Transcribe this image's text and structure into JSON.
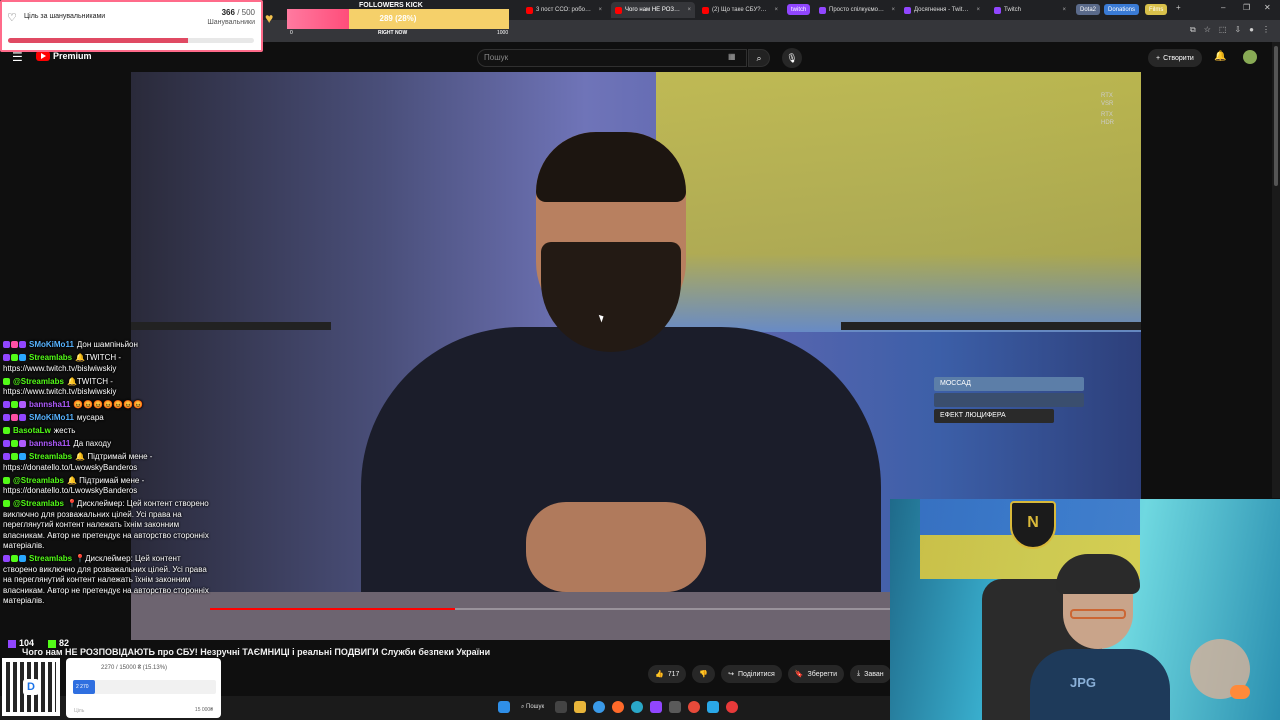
{
  "browser": {
    "tabs": [
      {
        "label": "3 пост ССО: робо…",
        "color": "#ff0000"
      },
      {
        "label": "Чого нам НЕ РОЗ…",
        "color": "#ff0000",
        "active": true
      },
      {
        "label": "(2) Що таке СБУ?…",
        "color": "#ff0000"
      },
      {
        "label": "Просто спілкуємо…",
        "color": "#9146ff"
      },
      {
        "label": "Досягнення - Twit…",
        "color": "#9146ff"
      },
      {
        "label": "Twitch",
        "color": "#9146ff"
      }
    ],
    "pills": [
      {
        "label": "twitch",
        "color": "#9146ff"
      },
      {
        "label": "Dota2",
        "color": "#5a6a8a"
      },
      {
        "label": "Donations",
        "color": "#3a7bd5"
      },
      {
        "label": "Films",
        "color": "#d8c04a"
      }
    ],
    "window_controls": [
      "–",
      "❐",
      "✕"
    ]
  },
  "youtube": {
    "logo_text": "Premium",
    "search_placeholder": "Пошук",
    "create_label": "Створити",
    "video_title": "Чого нам НЕ РОЗПОВІДАЮТЬ про СБУ! Незручні ТАЄМНИЦІ і реальні ПОДВИГИ Служби безпеки України",
    "likes": "717",
    "share_label": "Поділитися",
    "save_label": "Зберегти",
    "download_label": "Заван",
    "progress_fraction": 0.36,
    "overlay_text": [
      "RTX",
      "VSR",
      "RTX",
      "HDR"
    ],
    "books": [
      {
        "label": "МОССАД",
        "color": "#5c7ea8"
      },
      {
        "label": "",
        "color": "#3a4e6e"
      },
      {
        "label": "ЕФЕКТ ЛЮЦИФЕРА",
        "color": "#2a2a2a"
      }
    ]
  },
  "goal_widget": {
    "label": "Ціль за шанувальниками",
    "current": "366",
    "separator": " / ",
    "target": "500",
    "sub": "Шанувальники",
    "fraction": 0.732
  },
  "kick_widget": {
    "title": "FOLLOWERS KICK",
    "value": "289 (28%)",
    "fraction": 0.28,
    "min": "0",
    "mid": "RIGHT NOW",
    "max": "1000"
  },
  "chat": [
    {
      "user": "SMoKiMo11",
      "color": "#57b3ff",
      "badges": [
        "#9146ff",
        "#ff4fa3",
        "#9146ff"
      ],
      "text": "Дон шампіньйон"
    },
    {
      "user": "Streamlabs",
      "color": "#53fc18",
      "badges": [
        "#9146ff",
        "#53fc18",
        "#2aa8ff"
      ],
      "text": "🔔TWITCH - https://www.twitch.tv/bislwiwskiy"
    },
    {
      "user": "@Streamlabs",
      "color": "#53fc18",
      "badges": [
        "#53fc18"
      ],
      "text": "🔔TWITCH - https://www.twitch.tv/bislwiwskiy"
    },
    {
      "user": "bannsha11",
      "color": "#b05cff",
      "badges": [
        "#9146ff",
        "#53fc18",
        "#b05cff"
      ],
      "text": "😡😡😡😡😡😡😡"
    },
    {
      "user": "SMoKiMo11",
      "color": "#57b3ff",
      "badges": [
        "#9146ff",
        "#ff4fa3",
        "#9146ff"
      ],
      "text": "мусара"
    },
    {
      "user": "BasotaLw",
      "color": "#53fc18",
      "badges": [
        "#53fc18"
      ],
      "text": "жесть"
    },
    {
      "user": "bannsha11",
      "color": "#b05cff",
      "badges": [
        "#9146ff",
        "#53fc18",
        "#b05cff"
      ],
      "text": "Да паходу"
    },
    {
      "user": "Streamlabs",
      "color": "#53fc18",
      "badges": [
        "#9146ff",
        "#53fc18",
        "#2aa8ff"
      ],
      "text": "🔔 Підтримай мене - https://donatello.to/LwowskyBanderos"
    },
    {
      "user": "@Streamlabs",
      "color": "#53fc18",
      "badges": [
        "#53fc18"
      ],
      "text": "🔔 Підтримай мене - https://donatello.to/LwowskyBanderos"
    },
    {
      "user": "@Streamlabs",
      "color": "#53fc18",
      "badges": [
        "#53fc18"
      ],
      "text": "📍Дисклеймер: Цей контент створено виключно для розважальних цілей. Усі права на переглянутий контент належать їхнім законним власникам. Автор не претендує на авторство сторонніх матеріалів."
    },
    {
      "user": "Streamlabs",
      "color": "#53fc18",
      "badges": [
        "#9146ff",
        "#53fc18",
        "#2aa8ff"
      ],
      "text": "📍Дисклеймер: Цей контент створено виключно для розважальних цілей. Усі права на переглянутий контент належать їхнім законним власникам. Автор не претендує на авторство сторонніх матеріалів."
    }
  ],
  "counters": {
    "twitch_viewers": "104",
    "kick_viewers": "82",
    "twitch_color": "#9146ff",
    "kick_color": "#53fc18"
  },
  "donation": {
    "progress_text": "2270 / 15000 ₴ (15.13%)",
    "bar_text": "2 270",
    "goal_label": "Ціль",
    "goal_amount": "15 000₴",
    "fraction": 0.1513
  },
  "taskbar": {
    "search_label": "Пошук"
  },
  "webcam": {
    "emblem": "N",
    "shirt_text": "JPG"
  }
}
